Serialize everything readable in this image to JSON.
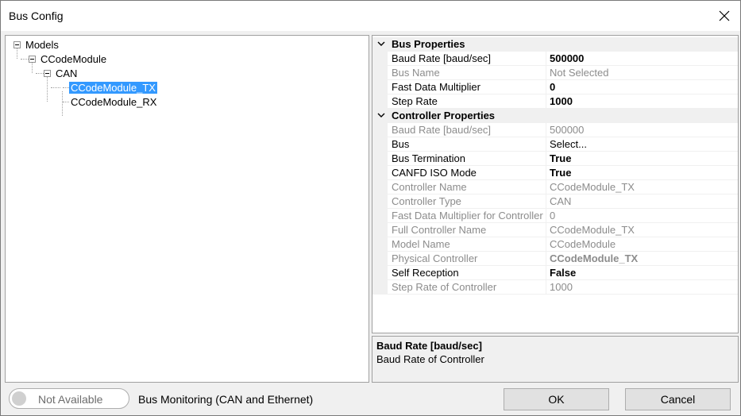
{
  "window": {
    "title": "Bus Config"
  },
  "tree": {
    "root": "Models",
    "module": "CCodeModule",
    "bus": "CAN",
    "items": [
      "CCodeModule_TX",
      "CCodeModule_RX"
    ]
  },
  "properties": {
    "bus_category": "Bus Properties",
    "bus_rows": [
      {
        "name": "Baud Rate [baud/sec]",
        "value": "500000"
      },
      {
        "name": "Bus Name",
        "value": "Not Selected"
      },
      {
        "name": "Fast Data Multiplier",
        "value": "0"
      },
      {
        "name": "Step Rate",
        "value": "1000"
      }
    ],
    "controller_category": "Controller Properties",
    "controller_rows": [
      {
        "name": "Baud Rate [baud/sec]",
        "value": "500000"
      },
      {
        "name": "Bus",
        "value": "Select..."
      },
      {
        "name": "Bus Termination",
        "value": "True"
      },
      {
        "name": "CANFD ISO Mode",
        "value": "True"
      },
      {
        "name": "Controller Name",
        "value": "CCodeModule_TX"
      },
      {
        "name": "Controller Type",
        "value": "CAN"
      },
      {
        "name": "Fast Data Multiplier for Controller",
        "value": "0"
      },
      {
        "name": "Full Controller Name",
        "value": "CCodeModule_TX"
      },
      {
        "name": "Model Name",
        "value": "CCodeModule"
      },
      {
        "name": "Physical Controller",
        "value": "CCodeModule_TX"
      },
      {
        "name": "Self Reception",
        "value": "False"
      },
      {
        "name": "Step Rate of Controller",
        "value": "1000"
      }
    ]
  },
  "description": {
    "title": "Baud Rate [baud/sec]",
    "text": "Baud Rate of Controller"
  },
  "footer": {
    "toggle_label": "Not Available",
    "monitoring_label": "Bus Monitoring (CAN and Ethernet)",
    "ok_label": "OK",
    "cancel_label": "Cancel"
  },
  "colors": {
    "selection": "#3399ff",
    "disabled_text": "#8c8c8c"
  }
}
